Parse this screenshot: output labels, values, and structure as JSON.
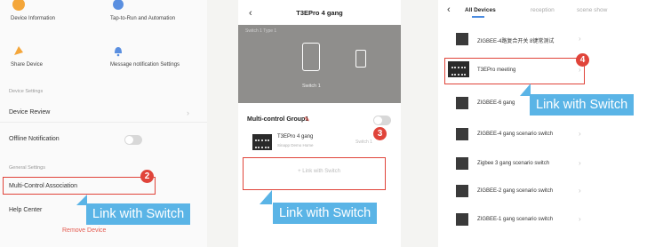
{
  "phone1": {
    "grid": [
      {
        "label": "Device Information",
        "icon": "device-info-icon"
      },
      {
        "label": "Tap-to-Run and Automation",
        "icon": "tap-to-run-icon"
      },
      {
        "label": "Share Device",
        "icon": "share-icon"
      },
      {
        "label": "Message notification Settings",
        "icon": "bell-icon"
      }
    ],
    "section_device": "Device Settings",
    "device_review": "Device Review",
    "offline_notification": "Offline Notification",
    "section_general": "General Settings",
    "multi_control": "Multi-Control Association",
    "help_center": "Help Center",
    "remove_device": "Remove Device",
    "step": "2",
    "callout": "Link with Switch"
  },
  "phone2": {
    "title": "T3EPro 4 gang",
    "dark_small_text": "Switch 1 Type 1",
    "switch_label": "Switch 1",
    "group_title": "Multi-control Group1",
    "device_name": "T3EPro 4 gang",
    "device_sub": "Sinapp Demo Home",
    "device_switch": "Switch 1",
    "link_button": "+ Link with Switch",
    "step": "3",
    "callout": "Link with Switch"
  },
  "phone3": {
    "tabs": [
      "All Devices",
      "reception",
      "scene show"
    ],
    "devices": [
      "ZIGBEE-4路复合开关 8键常测试",
      "T3EPro meeting",
      "ZIGBEE-6 gang",
      "ZIGBEE-4 gang scenario switch",
      "Zigbee 3 gang scenario switch",
      "ZIGBEE-2 gang scenario switch",
      "ZIGBEE-1 gang scenario switch"
    ],
    "step": "4",
    "callout": "Link with Switch"
  },
  "colors": {
    "accent_blue": "#5ab4e6",
    "highlight_red": "#e0443a"
  }
}
